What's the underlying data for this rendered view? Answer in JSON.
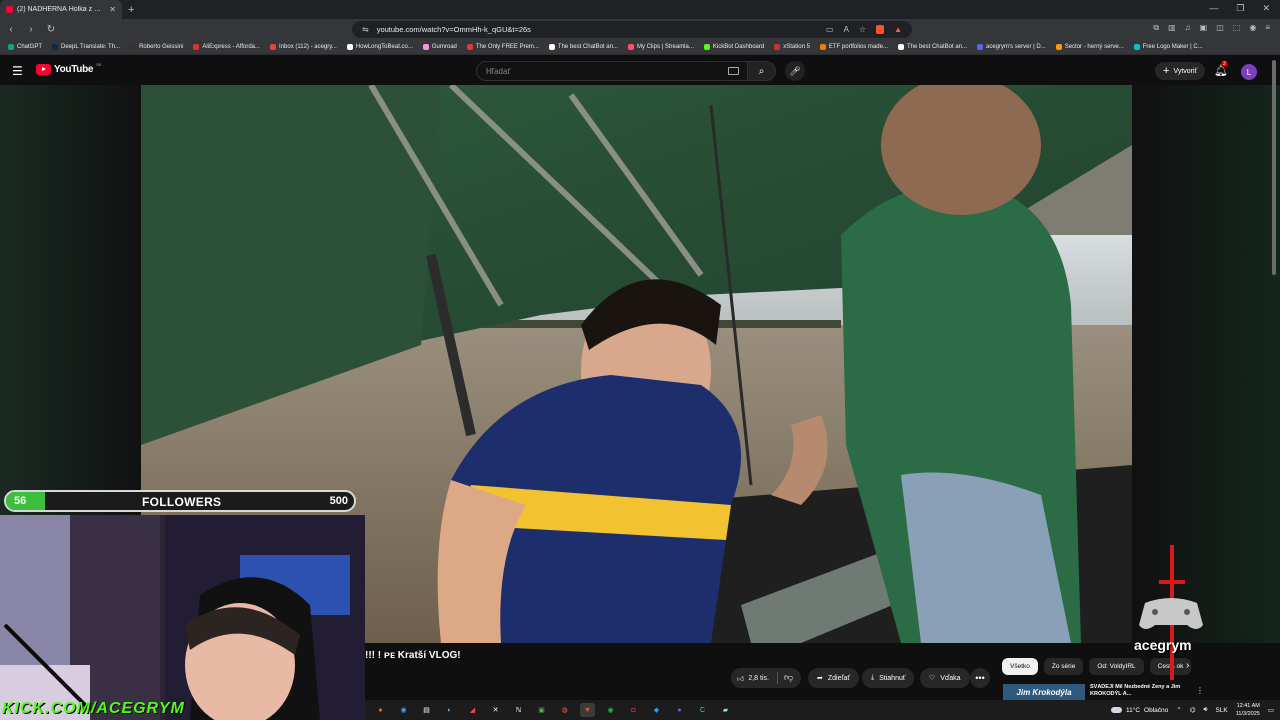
{
  "browser": {
    "tab_title": "(2) NÁDHERNÁ Holka z Džun",
    "url": "youtube.com/watch?v=OmmHh-k_qGU&t=26s",
    "bookmarks": [
      {
        "label": "ChatGPT",
        "color": "#10a37f"
      },
      {
        "label": "DeepL Translate: Th...",
        "color": "#0f2b46"
      },
      {
        "label": "Roberto Geissini",
        "color": "#333333"
      },
      {
        "label": "AliExpress - Afforda...",
        "color": "#e43225"
      },
      {
        "label": "Inbox (112) - acegry...",
        "color": "#ea4335"
      },
      {
        "label": "HowLongToBeat.co...",
        "color": "#ffffff"
      },
      {
        "label": "Gumroad",
        "color": "#ff90e8"
      },
      {
        "label": "The Only FREE Prem...",
        "color": "#e53935"
      },
      {
        "label": "The best ChatBot an...",
        "color": "#ffffff"
      },
      {
        "label": "My Clips | Streamla...",
        "color": "#ff4f6e"
      },
      {
        "label": "KickBot Dashboard",
        "color": "#53fc18"
      },
      {
        "label": "xStation 5",
        "color": "#d32f2f"
      },
      {
        "label": "ETF portfolios made...",
        "color": "#f57c00"
      },
      {
        "label": "The best ChatBot an...",
        "color": "#ffffff"
      },
      {
        "label": "acegrym's server | D...",
        "color": "#5865f2"
      },
      {
        "label": "Sector - herný serve...",
        "color": "#ff9800"
      },
      {
        "label": "Free Logo Maker | C...",
        "color": "#00c4cc"
      }
    ]
  },
  "youtube": {
    "logo": "YouTube",
    "country": "SK",
    "search_placeholder": "Hľadať",
    "create_label": "Vytvoriť",
    "notif_count": "2",
    "avatar_letter": "L",
    "video_title": "!!! ! ᴘᴇ Kratší VLOG!",
    "likes": "2,8 tis.",
    "share": "Zdieľať",
    "download": "Stiahnuť",
    "thanks": "Vďaka",
    "more": "•••",
    "chips": [
      "Všetko",
      "Zo série",
      "Od: VoldyIRL",
      "Cesta ok"
    ],
    "rec_thumb": "Jim Krokodýla",
    "rec_title": "SVÁDĚJÍ Mě Nezbedné Ženy a Jim KROKODÝL A..."
  },
  "stream": {
    "followers_current": 56,
    "followers_label": "FOLLOWERS",
    "followers_goal": 500,
    "kick_text": "KICK.COM/ACEGRYM",
    "ace_text": "acegrym",
    "accent": "#53fc18"
  },
  "taskbar": {
    "weather": "11°C",
    "weather_desc": "Oblačno",
    "lang": "SLK",
    "time": "12:41 AM",
    "date": "11/3/2025"
  }
}
